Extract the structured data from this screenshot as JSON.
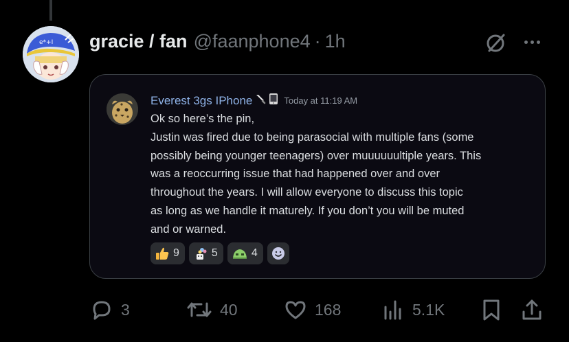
{
  "post": {
    "display_name": "gracie / fan",
    "handle": "@faanphone4",
    "separator": "·",
    "time": "1h"
  },
  "icons": {
    "grok": "grok-slash-circle-icon",
    "more": "more-horizontal-icon"
  },
  "screenshot": {
    "username": "Everest 3gs IPhone",
    "timestamp": "Today at 11:19 AM",
    "lines": [
      "Ok so here’s the pin,",
      "Justin was fired due to being parasocial with multiple fans (some",
      "possibly being younger teenagers) over muuuuuultiple years. This",
      "was a reoccurring issue that had happened over and over",
      "throughout the years. I will allow everyone to discuss this topic",
      "as long as we handle it maturely. If you don’t you will be muted",
      "and or warned."
    ],
    "reactions": [
      {
        "emoji": "thumbs-up",
        "count": "9"
      },
      {
        "emoji": "flower-pot",
        "count": "5"
      },
      {
        "emoji": "green-blob",
        "count": "4"
      }
    ],
    "username_color": "#8fb3e8"
  },
  "actions": {
    "replies": "3",
    "reposts": "40",
    "likes": "168",
    "views": "5.1K"
  },
  "colors": {
    "background": "#000000",
    "muted": "#71767b",
    "text": "#e7e9ea",
    "card_bg": "#0b0a12"
  }
}
